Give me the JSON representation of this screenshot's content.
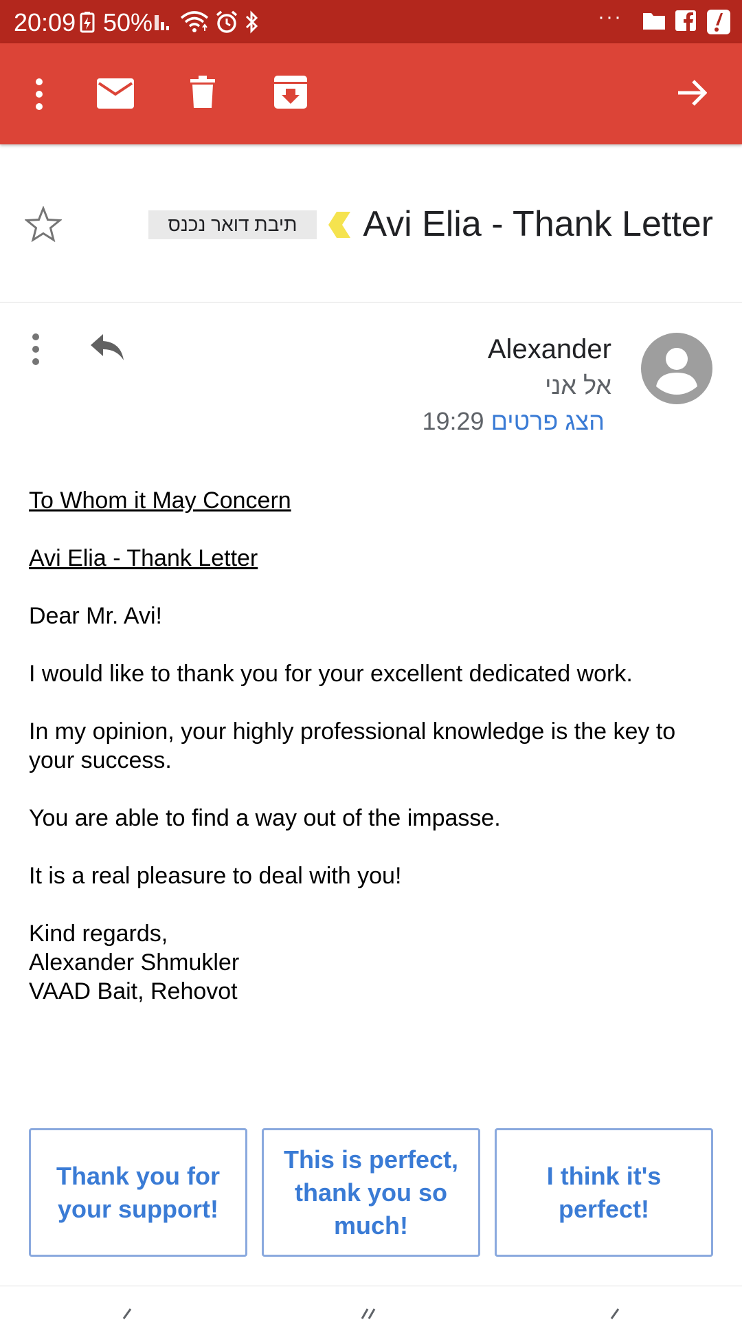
{
  "status_bar": {
    "time": "20:09",
    "battery_percent": "50%",
    "overflow": "···",
    "icons": [
      "battery-charging-icon",
      "signal-icon",
      "wifi-icon",
      "alarm-icon",
      "bluetooth-icon",
      "folder-icon",
      "facebook-icon",
      "alert-icon"
    ]
  },
  "toolbar": {
    "icons": [
      "more-vert-icon",
      "mail-icon",
      "delete-icon",
      "archive-icon",
      "forward-arrow-icon"
    ]
  },
  "subject": {
    "title": "Avi Elia - Thank Letter",
    "label": "תיבת דואר נכנס"
  },
  "sender": {
    "name": "Alexander",
    "recipient": "אל אני",
    "time": "19:29",
    "details_link": "הצג פרטים"
  },
  "body": {
    "line1": "To Whom it May Concern",
    "line2": "Avi Elia - Thank Letter",
    "greeting": "Dear Mr. Avi!",
    "p1": "I would like to thank you for your excellent dedicated work.",
    "p2": "In my opinion, your highly professional knowledge is the key to your success.",
    "p3": "You are able to find a way out of the impasse.",
    "p4": "It is a real pleasure to deal with you!",
    "sign1": "Kind regards,",
    "sign2": "Alexander Shmukler",
    "sign3": "VAAD Bait, Rehovot"
  },
  "smart_replies": [
    "Thank you for your support!",
    "This is perfect, thank you so much!",
    "I think it's perfect!"
  ],
  "colors": {
    "status_bar": "#b3271d",
    "toolbar": "#dc4437",
    "link": "#3a7bd5",
    "importance": "#f5e34f"
  }
}
